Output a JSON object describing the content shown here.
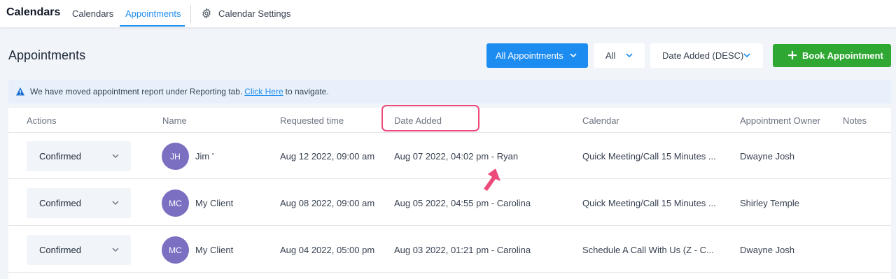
{
  "topnav": {
    "app_title": "Calendars",
    "links": [
      "Calendars",
      "Appointments"
    ],
    "active_link": "Appointments",
    "settings_label": "Calendar Settings"
  },
  "page": {
    "title": "Appointments"
  },
  "filters": {
    "view": "All Appointments",
    "status": "All",
    "sort": "Date Added (DESC)"
  },
  "actions": {
    "book_label": "Book Appointment"
  },
  "banner": {
    "text_before": "We have moved appointment report under Reporting tab.",
    "link_text": "Click Here",
    "text_after": "to navigate."
  },
  "table": {
    "columns": [
      "Actions",
      "Name",
      "Requested time",
      "Date Added",
      "Calendar",
      "Appointment Owner",
      "Notes"
    ],
    "rows": [
      {
        "status": "Confirmed",
        "initials": "JH",
        "name": "Jim '",
        "requested": "Aug 12 2022, 09:00 am",
        "date_added": "Aug 07 2022, 04:02 pm - Ryan",
        "calendar": "Quick Meeting/Call 15 Minutes ...",
        "owner": "Dwayne Josh",
        "notes": ""
      },
      {
        "status": "Confirmed",
        "initials": "MC",
        "name": "My Client",
        "requested": "Aug 08 2022, 09:00 am",
        "date_added": "Aug 05 2022, 04:55 pm - Carolina",
        "calendar": "Quick Meeting/Call 15 Minutes ...",
        "owner": "Shirley Temple",
        "notes": ""
      },
      {
        "status": "Confirmed",
        "initials": "MC",
        "name": "My Client",
        "requested": "Aug 04 2022, 05:00 pm",
        "date_added": "Aug 03 2022, 01:21 pm - Carolina",
        "calendar": "Schedule A Call With Us (Z - C...",
        "owner": "Dwayne Josh",
        "notes": ""
      }
    ]
  },
  "colors": {
    "primary_blue": "#1d8cf0",
    "success_green": "#2ea832",
    "annotation_pink": "#ec4a7a",
    "avatar_purple": "#7b6fc2"
  },
  "icons": [
    "gear-icon",
    "chevron-down-icon",
    "plus-icon",
    "info-icon",
    "arrow-annotation"
  ]
}
